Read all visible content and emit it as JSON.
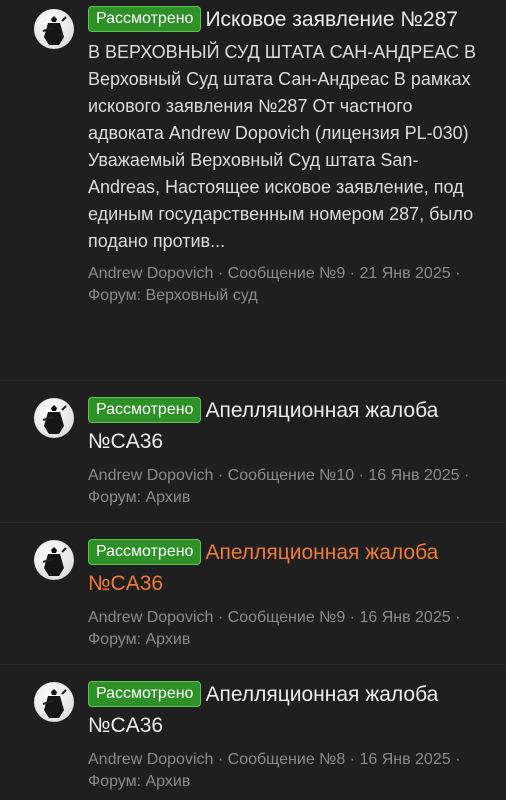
{
  "threads": [
    {
      "status": "Рассмотрено",
      "title": "Исковое заявление №287",
      "snippet": "В ВЕРХОВНЫЙ СУД ШТАТА САН-АНДРЕАС В Верховный Суд штата Сан-Андреас В рамках искового заявления №287 От частного адвоката Andrew Dopovich (лицензия PL-030) Уважаемый Верховный Суд штата San-Andreas, Настоящее исковое заявление, под единым государственным номером 287, было подано против...",
      "author": "Andrew Dopovich",
      "message": "Сообщение №9",
      "date": "21 Янв 2025",
      "forum": "Форум: Верховный суд"
    },
    {
      "status": "Рассмотрено",
      "title": "Апелляционная жалоба №CA36",
      "author": "Andrew Dopovich",
      "message": "Сообщение №10",
      "date": "16 Янв 2025",
      "forum": "Форум: Архив"
    },
    {
      "status": "Рассмотрено",
      "title": "Апелляционная жалоба №CA36",
      "author": "Andrew Dopovich",
      "message": "Сообщение №9",
      "date": "16 Янв 2025",
      "forum": "Форум: Архив"
    },
    {
      "status": "Рассмотрено",
      "title": "Апелляционная жалоба №CA36",
      "author": "Andrew Dopovich",
      "message": "Сообщение №8",
      "date": "16 Янв 2025",
      "forum": "Форум: Архив"
    }
  ],
  "separator": "·",
  "colors": {
    "background": "#1f1f1f",
    "badge": "#2e9127",
    "visited_title": "#f07a3a",
    "meta_text": "#8b8b8b"
  },
  "icons": {
    "avatar": "samurai-avatar-icon"
  }
}
